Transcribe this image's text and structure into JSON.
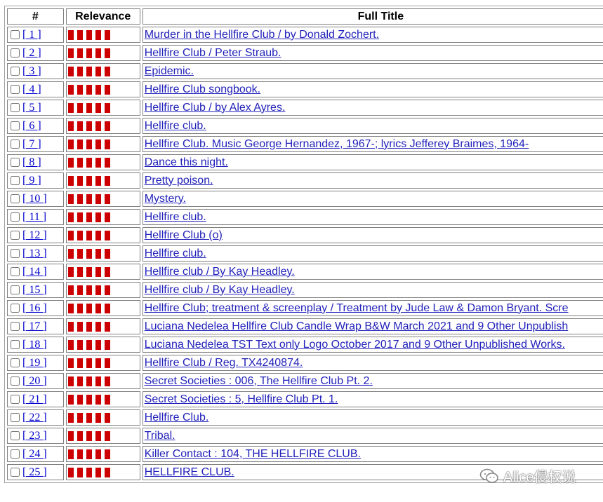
{
  "header": {
    "num": "#",
    "relevance": "Relevance",
    "title": "Full Title"
  },
  "bar_color": "#cc0000",
  "rows": [
    {
      "num": "[ 1 ]",
      "bars": 5,
      "title": "Murder in the Hellfire Club / by Donald Zochert."
    },
    {
      "num": "[ 2 ]",
      "bars": 5,
      "title": "Hellfire Club / Peter Straub."
    },
    {
      "num": "[ 3 ]",
      "bars": 5,
      "title": "Epidemic."
    },
    {
      "num": "[ 4 ]",
      "bars": 5,
      "title": "Hellfire Club songbook."
    },
    {
      "num": "[ 5 ]",
      "bars": 5,
      "title": "Hellfire Club / by Alex Ayres."
    },
    {
      "num": "[ 6 ]",
      "bars": 5,
      "title": "Hellfire club."
    },
    {
      "num": "[ 7 ]",
      "bars": 5,
      "title": "Hellfire Club. Music George Hernandez, 1967-; lyrics Jefferey Braimes, 1964-"
    },
    {
      "num": "[ 8 ]",
      "bars": 5,
      "title": "Dance this night."
    },
    {
      "num": "[ 9 ]",
      "bars": 5,
      "title": "Pretty poison."
    },
    {
      "num": "[ 10 ]",
      "bars": 5,
      "title": "Mystery."
    },
    {
      "num": "[ 11 ]",
      "bars": 5,
      "title": "Hellfire club."
    },
    {
      "num": "[ 12 ]",
      "bars": 5,
      "title": "Hellfire Club (o)"
    },
    {
      "num": "[ 13 ]",
      "bars": 5,
      "title": "Hellfire club."
    },
    {
      "num": "[ 14 ]",
      "bars": 5,
      "title": "Hellfire club / By Kay Headley."
    },
    {
      "num": "[ 15 ]",
      "bars": 5,
      "title": "Hellfire club / By Kay Headley."
    },
    {
      "num": "[ 16 ]",
      "bars": 5,
      "title": "Hellfire Club; treatment & screenplay / Treatment by Jude Law & Damon Bryant. Scre"
    },
    {
      "num": "[ 17 ]",
      "bars": 5,
      "title": "Luciana Nedelea Hellfire Club Candle Wrap B&W March 2021 and 9 Other Unpublish"
    },
    {
      "num": "[ 18 ]",
      "bars": 5,
      "title": "Luciana Nedelea TST Text only Logo October 2017 and 9 Other Unpublished Works."
    },
    {
      "num": "[ 19 ]",
      "bars": 5,
      "title": "Hellfire Club / Reg. TX4240874."
    },
    {
      "num": "[ 20 ]",
      "bars": 5,
      "title": "Secret Societies : 006, The Hellfire Club Pt. 2."
    },
    {
      "num": "[ 21 ]",
      "bars": 5,
      "title": "Secret Societies : 5, Hellfire Club Pt. 1."
    },
    {
      "num": "[ 22 ]",
      "bars": 5,
      "title": "Hellfire Club."
    },
    {
      "num": "[ 23 ]",
      "bars": 5,
      "title": "Tribal."
    },
    {
      "num": "[ 24 ]",
      "bars": 5,
      "title": "Killer Contact : 104, THE HELLFIRE CLUB."
    },
    {
      "num": "[ 25 ]",
      "bars": 5,
      "title": "HELLFIRE CLUB."
    }
  ],
  "watermark": {
    "text": "Alice侵权说",
    "icon": "wechat-icon"
  }
}
